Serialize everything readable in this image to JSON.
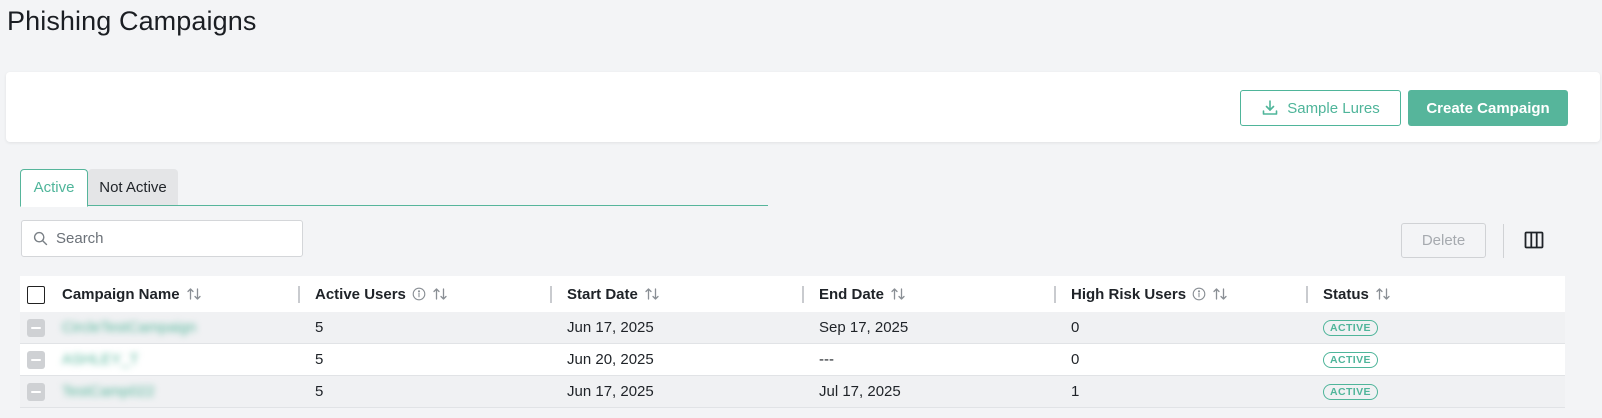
{
  "page": {
    "title": "Phishing Campaigns"
  },
  "actions": {
    "sample_lures_label": "Sample Lures",
    "create_campaign_label": "Create Campaign"
  },
  "tabs": [
    {
      "label": "Active",
      "active": true
    },
    {
      "label": "Not Active",
      "active": false
    }
  ],
  "search": {
    "placeholder": "Search",
    "value": ""
  },
  "toolbar": {
    "delete_label": "Delete"
  },
  "icons": {
    "download": "download-icon",
    "search": "search-icon",
    "columns": "columns-icon",
    "sort": "sort-icon",
    "info": "info-icon"
  },
  "colors": {
    "accent": "#56b59b",
    "page_bg": "#f3f4f6"
  },
  "table": {
    "columns": [
      {
        "label": "Campaign Name"
      },
      {
        "label": "Active Users"
      },
      {
        "label": "Start Date"
      },
      {
        "label": "End Date"
      },
      {
        "label": "High Risk Users"
      },
      {
        "label": "Status"
      }
    ],
    "rows": [
      {
        "name": "CircleTestCampaign",
        "active_users": "5",
        "start_date": "Jun 17, 2025",
        "end_date": "Sep 17, 2025",
        "high_risk_users": "0",
        "status": "ACTIVE"
      },
      {
        "name": "ASHLEY_T",
        "active_users": "5",
        "start_date": "Jun 20, 2025",
        "end_date": "---",
        "high_risk_users": "0",
        "status": "ACTIVE"
      },
      {
        "name": "TestCamp022",
        "active_users": "5",
        "start_date": "Jun 17, 2025",
        "end_date": "Jul 17, 2025",
        "high_risk_users": "1",
        "status": "ACTIVE"
      }
    ]
  }
}
